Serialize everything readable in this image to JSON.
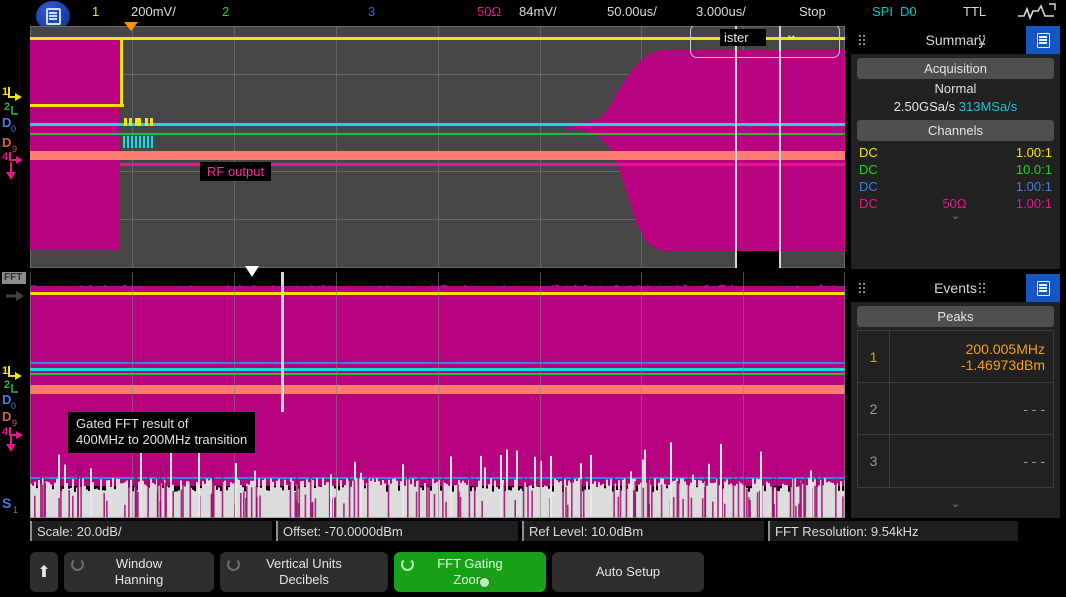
{
  "topbar": {
    "menu_icon": "menu-list-icon",
    "ch1_num": "1",
    "ch1_scale": "200mV/",
    "ch2_num": "2",
    "ch3_num": "3",
    "ch4_imp": "50Ω",
    "ch4_scale": "84mV/",
    "timebase": "50.00us/",
    "delay": "3.000us/",
    "run_state": "Stop",
    "serial_bus": "SPI",
    "digital": "D0",
    "logic_family": "TTL",
    "wave_icon": "trigger-waveform-icon"
  },
  "scope": {
    "edge_markers_top": [
      {
        "label": "1",
        "color": "#f2e600"
      },
      {
        "label": "2",
        "color": "#21b94a"
      },
      {
        "label": "D0",
        "color": "#3d7ee8"
      },
      {
        "label": "D9",
        "color": "#fb7d72"
      },
      {
        "label": "4",
        "color": "#e8168c"
      }
    ],
    "edge_markers_fft": [
      {
        "label": "1",
        "color": "#f2e600"
      },
      {
        "label": "2",
        "color": "#21b94a"
      },
      {
        "label": "D0",
        "color": "#3d7ee8"
      },
      {
        "label": "D9",
        "color": "#fb7d72"
      },
      {
        "label": "4",
        "color": "#e8168c"
      },
      {
        "label": "S1",
        "color": "#3d7ee8"
      }
    ],
    "fft_tag": "FFT",
    "register_label": "ister",
    "chevron": "⌄",
    "rf_output_label": "RF output",
    "note_line1": "Gated FFT result of",
    "note_line2": "400MHz to 200MHz transition"
  },
  "sidebar": {
    "summary": {
      "title": "Summary",
      "panel_icon": "list-panel-icon",
      "acquisition_label": "Acquisition",
      "mode": "Normal",
      "sample_rate": "2.50GSa/s",
      "mem_rate": "313MSa/s",
      "channels_label": "Channels",
      "channels": [
        {
          "coupling": "DC",
          "impedance": "",
          "probe": "1.00:1",
          "color": "#f2e600"
        },
        {
          "coupling": "DC",
          "impedance": "",
          "probe": "10.0:1",
          "color": "#21d421"
        },
        {
          "coupling": "DC",
          "impedance": "",
          "probe": "1.00:1",
          "color": "#3d7ee8"
        },
        {
          "coupling": "DC",
          "impedance": "50Ω",
          "probe": "1.00:1",
          "color": "#e8168c"
        }
      ],
      "expand_caret": "⌄"
    },
    "events": {
      "title": "Events",
      "panel_icon": "list-panel-icon",
      "peaks_label": "Peaks",
      "rows": [
        {
          "index": "1",
          "freq": "200.005MHz",
          "amp": "-1.46973dBm"
        },
        {
          "index": "2",
          "freq": "",
          "amp": "- - -"
        },
        {
          "index": "3",
          "freq": "",
          "amp": "- - -"
        }
      ],
      "expand_caret": "⌄"
    }
  },
  "measurements": [
    {
      "text": "Scale: 20.0dB/"
    },
    {
      "text": "Offset: -70.0000dBm"
    },
    {
      "text": "Ref Level: 10.0dBm"
    },
    {
      "text": "FFT Resolution: 9.54kHz"
    }
  ],
  "softkeys": {
    "up_icon": "arrow-up-icon",
    "keys": [
      {
        "line1": "Window",
        "line2": "Hanning",
        "active": false,
        "knob": true
      },
      {
        "line1": "Vertical Units",
        "line2": "Decibels",
        "active": false,
        "knob": true
      },
      {
        "line1": "FFT Gating",
        "line2": "Zoom",
        "active": true,
        "knob": true
      },
      {
        "line1": "Auto Setup",
        "line2": "",
        "active": false,
        "knob": false
      }
    ]
  },
  "colors": {
    "ch1": "#f2e600",
    "ch2": "#21d421",
    "ch3": "#2f5fe0",
    "ch4": "#e8168c",
    "accent_blue": "#1456c4",
    "peak_orange": "#f0a020",
    "softkey_green": "#17a117",
    "graticule": "#464646"
  }
}
